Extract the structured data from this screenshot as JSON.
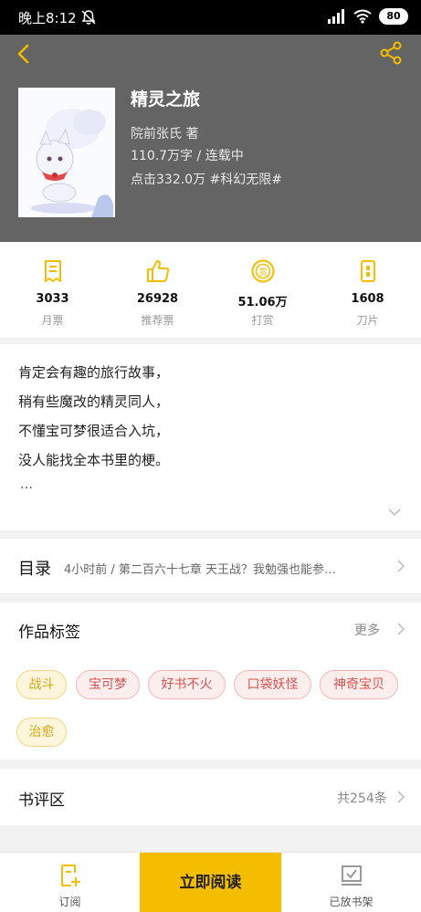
{
  "status_bar": {
    "time": "晚上8:12",
    "battery": "80"
  },
  "book": {
    "title": "精灵之旅",
    "author": "院前张氏  著",
    "words_status": "110.7万字 / 连载中",
    "clicks_tag": "点击332.0万  #科幻无限#"
  },
  "stats": [
    {
      "value": "3033",
      "label": "月票",
      "icon": "monthly-ticket-icon"
    },
    {
      "value": "26928",
      "label": "推荐票",
      "icon": "thumbs-up-icon"
    },
    {
      "value": "51.06万",
      "label": "打赏",
      "icon": "reward-coin-icon"
    },
    {
      "value": "1608",
      "label": "刀片",
      "icon": "blade-icon"
    }
  ],
  "description": {
    "lines": [
      "肯定会有趣的旅行故事，",
      "稍有些魔改的精灵同人，",
      "不懂宝可梦很适合入坑，",
      "没人能找全本书里的梗。"
    ],
    "ellipsis": "…"
  },
  "catalog": {
    "title": "目录",
    "latest": "4小时前 / 第二百六十七章  天王战？我勉强也能参…"
  },
  "tags": {
    "title": "作品标签",
    "more": "更多",
    "items": [
      {
        "label": "战斗",
        "color": "yellow"
      },
      {
        "label": "宝可梦",
        "color": "pink"
      },
      {
        "label": "好书不火",
        "color": "pink"
      },
      {
        "label": "口袋妖怪",
        "color": "pink"
      },
      {
        "label": "神奇宝贝",
        "color": "pink"
      },
      {
        "label": "治愈",
        "color": "yellow"
      }
    ]
  },
  "reviews": {
    "title": "书评区",
    "count": "共254条"
  },
  "bottom_bar": {
    "subscribe": "订阅",
    "read_now": "立即阅读",
    "on_shelf": "已放书架"
  },
  "colors": {
    "accent": "#f5bd00",
    "header_bg": "#646464"
  }
}
